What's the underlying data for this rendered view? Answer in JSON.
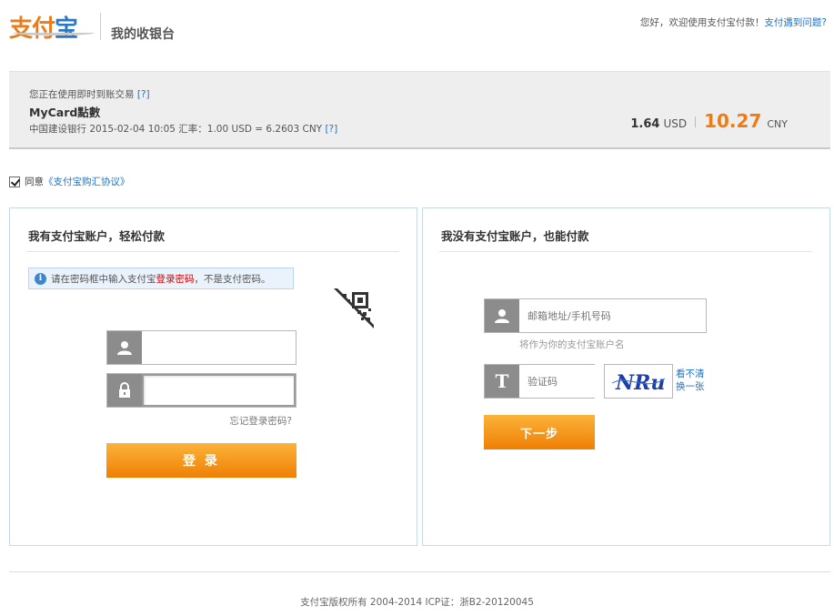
{
  "header": {
    "logo_text_a": "支付",
    "logo_text_b": "宝",
    "subtitle": "我的收银台",
    "welcome_prefix": "您好，欢迎使用支付宝付款！",
    "help_link": "支付遇到问题?"
  },
  "order": {
    "trade_type": "您正在使用即时到账交易",
    "trade_help": "[?]",
    "product_name": "MyCard點數",
    "rate_info": "中国建设银行 2015-02-04 10:05 汇率：1.00 USD = 6.2603 CNY",
    "rate_help": "[?]",
    "usd_amount": "1.64",
    "usd_currency": "USD",
    "cny_amount": "10.27",
    "cny_currency": "CNY"
  },
  "agreement": {
    "checked": true,
    "prefix": "同意",
    "link": "《支付宝购汇协议》"
  },
  "login_panel": {
    "title": "我有支付宝账户，轻松付款",
    "tip_prefix": "请在密码框中输入支付宝",
    "tip_highlight": "登录密码",
    "tip_suffix": "，不是支付密码。",
    "username_value": "",
    "password_value": "",
    "forgot_link": "忘记登录密码?",
    "login_button": "登 录"
  },
  "guest_panel": {
    "title": "我没有支付宝账户，也能付款",
    "account_placeholder": "邮箱地址/手机号码",
    "account_hint": "将作为你的支付宝账户名",
    "captcha_icon_letter": "T",
    "captcha_placeholder": "验证码",
    "captcha_text": "NRu",
    "refresh_link": "看不清换一张",
    "next_button": "下一步"
  },
  "footer": {
    "copyright": "支付宝版权所有 2004-2014 ICP证：浙B2-20120045"
  },
  "colors": {
    "accent_orange": "#f07b12",
    "link_blue": "#1e72c5",
    "icon_gray": "#8c8c8c"
  }
}
